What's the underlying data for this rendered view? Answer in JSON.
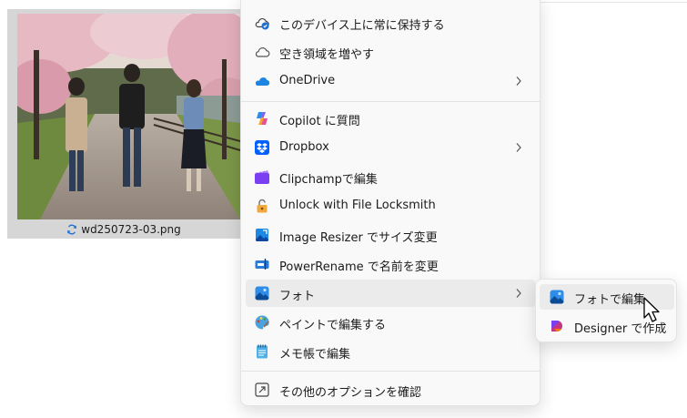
{
  "file": {
    "name": "wd250723-03.png"
  },
  "menu": {
    "items": [
      {
        "label": "このデバイス上に常に保持する",
        "icon": "cloud-keep-icon"
      },
      {
        "label": "空き領域を増やす",
        "icon": "cloud-outline-icon"
      },
      {
        "label": "OneDrive",
        "icon": "onedrive-icon",
        "submenu": true
      },
      {
        "label": "Copilot に質問",
        "icon": "copilot-icon"
      },
      {
        "label": "Dropbox",
        "icon": "dropbox-icon",
        "submenu": true
      },
      {
        "label": "Clipchampで編集",
        "icon": "clipchamp-icon"
      },
      {
        "label": "Unlock with File Locksmith",
        "icon": "lock-icon"
      },
      {
        "label": "Image Resizer でサイズ変更",
        "icon": "image-resizer-icon"
      },
      {
        "label": "PowerRename で名前を変更",
        "icon": "power-rename-icon"
      },
      {
        "label": "フォト",
        "icon": "photos-icon",
        "submenu": true,
        "highlighted": true
      },
      {
        "label": "ペイントで編集する",
        "icon": "paint-icon"
      },
      {
        "label": "メモ帳で編集",
        "icon": "notepad-icon"
      },
      {
        "label": "その他のオプションを確認",
        "icon": "more-options-icon"
      }
    ]
  },
  "submenu": {
    "items": [
      {
        "label": "フォトで編集",
        "icon": "photos-icon",
        "highlighted": true
      },
      {
        "label": "Designer で作成",
        "icon": "designer-icon"
      }
    ]
  }
}
